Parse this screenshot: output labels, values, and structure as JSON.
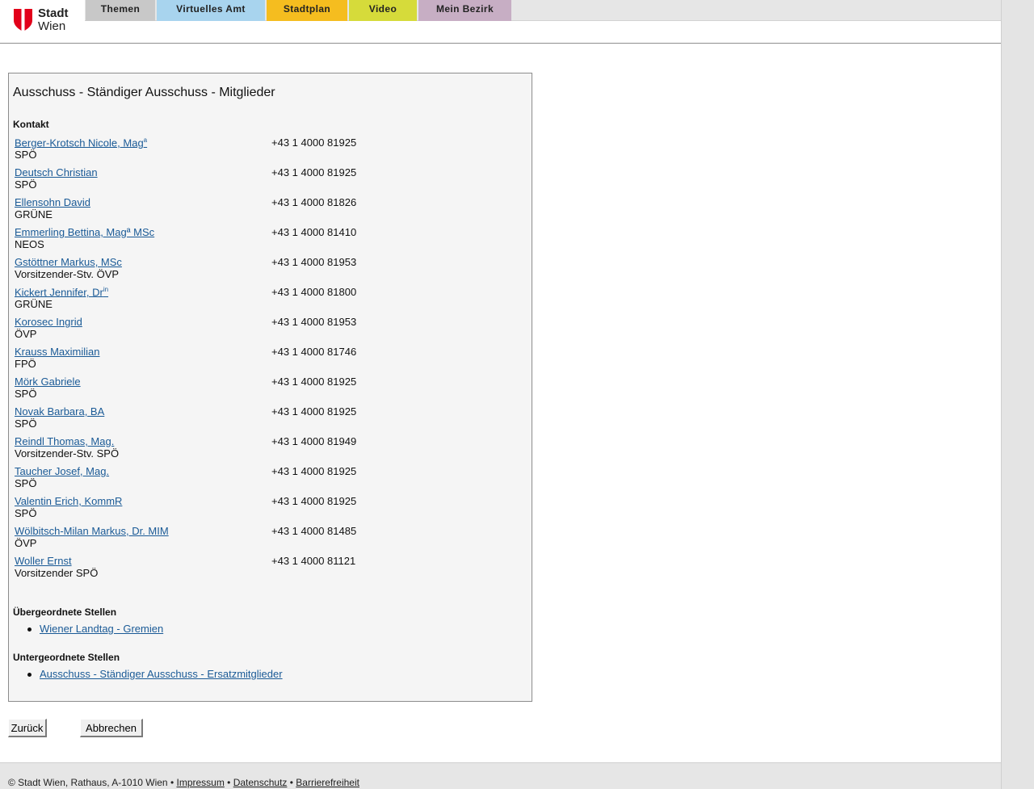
{
  "brand": {
    "line1": "Stadt",
    "line2": "Wien",
    "color": "#e2001a"
  },
  "nav": {
    "tabs": [
      {
        "label": "Themen",
        "color": "#c8c8c8"
      },
      {
        "label": "Virtuelles Amt",
        "color": "#a8d4ee"
      },
      {
        "label": "Stadtplan",
        "color": "#f5bd1f"
      },
      {
        "label": "Video",
        "color": "#d6db3a"
      },
      {
        "label": "Mein Bezirk",
        "color": "#c7aec4"
      }
    ]
  },
  "panel": {
    "title": "Ausschuss - Ständiger Ausschuss - Mitglieder",
    "contact_label": "Kontakt",
    "members": [
      {
        "name": "Berger-Krotsch Nicole, Mag",
        "sup": "a",
        "party": "SPÖ",
        "phone": "+43 1 4000 81925"
      },
      {
        "name": "Deutsch Christian",
        "sup": "",
        "party": "SPÖ",
        "phone": "+43 1 4000 81925"
      },
      {
        "name": "Ellensohn David",
        "sup": "",
        "party": "GRÜNE",
        "phone": "+43 1 4000 81826"
      },
      {
        "name": "Emmerling Bettina, Magª MSc",
        "sup": "",
        "party": "NEOS",
        "phone": "+43 1 4000 81410"
      },
      {
        "name": "Gstöttner Markus, MSc",
        "sup": "",
        "party": "Vorsitzender-Stv. ÖVP",
        "phone": "+43 1 4000 81953"
      },
      {
        "name": "Kickert Jennifer, Dr",
        "sup": "in",
        "party": "GRÜNE",
        "phone": "+43 1 4000 81800"
      },
      {
        "name": "Korosec Ingrid",
        "sup": "",
        "party": "ÖVP",
        "phone": "+43 1 4000 81953"
      },
      {
        "name": "Krauss Maximilian",
        "sup": "",
        "party": "FPÖ",
        "phone": "+43 1 4000 81746"
      },
      {
        "name": "Mörk Gabriele",
        "sup": "",
        "party": "SPÖ",
        "phone": "+43 1 4000 81925"
      },
      {
        "name": "Novak Barbara, BA",
        "sup": "",
        "party": "SPÖ",
        "phone": "+43 1 4000 81925"
      },
      {
        "name": "Reindl Thomas, Mag.",
        "sup": "",
        "party": "Vorsitzender-Stv. SPÖ",
        "phone": "+43 1 4000 81949"
      },
      {
        "name": "Taucher Josef, Mag.",
        "sup": "",
        "party": "SPÖ",
        "phone": "+43 1 4000 81925"
      },
      {
        "name": "Valentin Erich, KommR",
        "sup": "",
        "party": "SPÖ",
        "phone": "+43 1 4000 81925"
      },
      {
        "name": "Wölbitsch-Milan Markus, Dr. MIM",
        "sup": "",
        "party": "ÖVP",
        "phone": "+43 1 4000 81485"
      },
      {
        "name": "Woller Ernst",
        "sup": "",
        "party": "Vorsitzender SPÖ",
        "phone": "+43 1 4000 81121"
      }
    ],
    "parent_label": "Übergeordnete Stellen",
    "parent_link": "Wiener Landtag - Gremien",
    "child_label": "Untergeordnete Stellen",
    "child_link": "Ausschuss - Ständiger Ausschuss - Ersatzmitglieder"
  },
  "buttons": {
    "back": "Zurück",
    "cancel": "Abbrechen"
  },
  "footer": {
    "copyright": "© Stadt Wien, Rathaus, A-1010 Wien",
    "sep": " • ",
    "impressum": "Impressum",
    "datenschutz": "Datenschutz",
    "barrierefreiheit": "Barrierefreiheit"
  }
}
